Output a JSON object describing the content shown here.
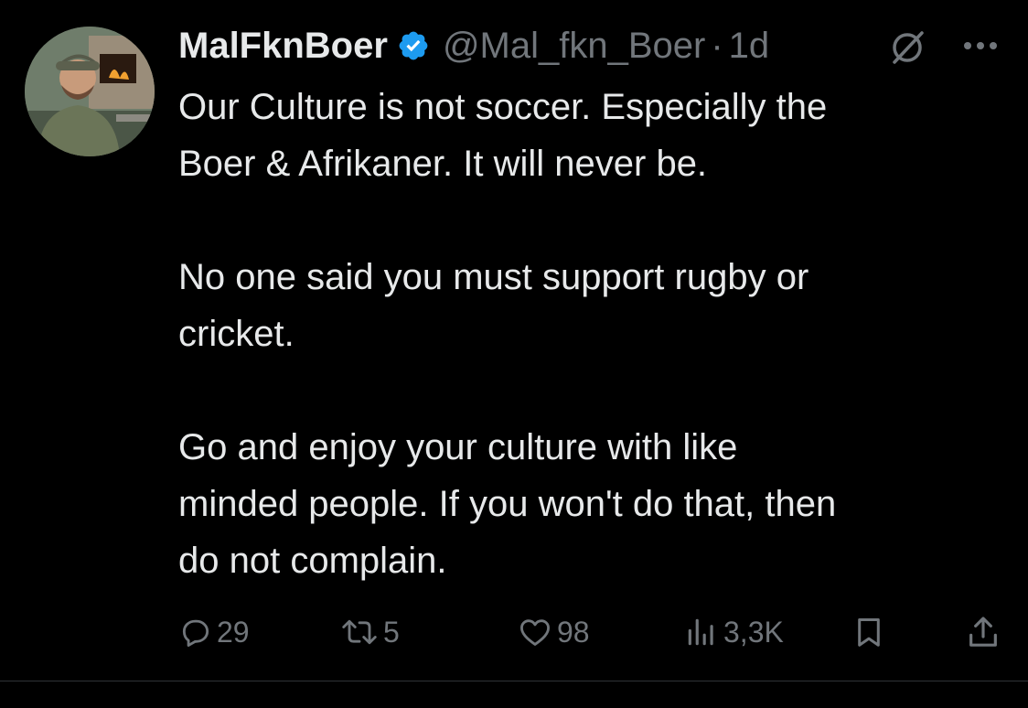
{
  "author": {
    "display_name": "MalFknBoer",
    "handle": "@Mal_fkn_Boer",
    "separator": "·",
    "timestamp": "1d",
    "verified_icon": "verified-badge-icon",
    "verified_color": "#1d9bf0"
  },
  "tweet": {
    "paragraphs": [
      [
        "Our Culture is not soccer. Especially the",
        "Boer & Afrikaner. It will never be."
      ],
      [
        "No one said you must support rugby or",
        "cricket."
      ],
      [
        "Go and enjoy your culture with like",
        "minded people. If you won't do that, then",
        "do not complain."
      ]
    ]
  },
  "actions": {
    "replies": "29",
    "reposts": "5",
    "likes": "98",
    "views": "3,3K"
  },
  "colors": {
    "background": "#000000",
    "primary_text": "#e7e9ea",
    "secondary_text": "#71767b",
    "divider": "#2f3336"
  }
}
